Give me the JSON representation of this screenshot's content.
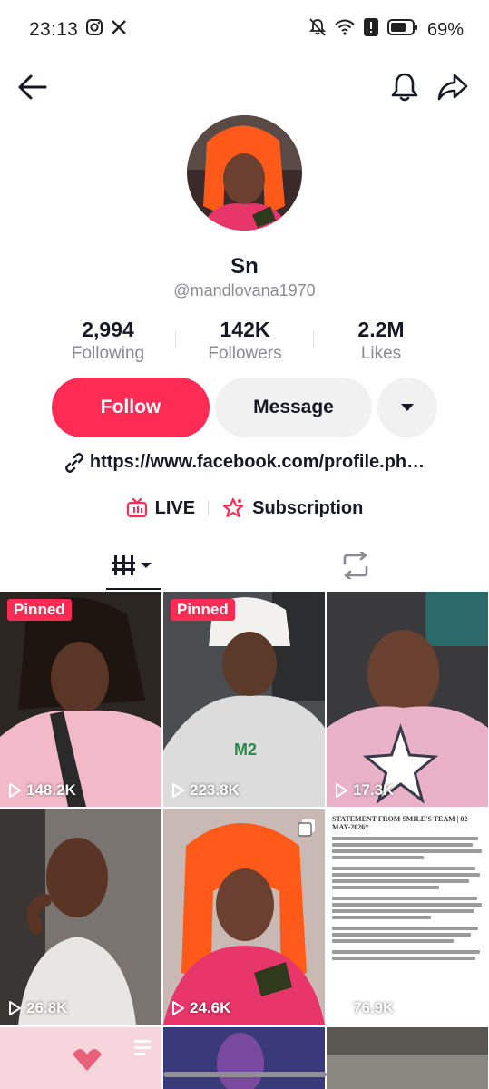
{
  "status_bar": {
    "time": "23:13",
    "battery_percent": "69%"
  },
  "profile": {
    "display_name": "Sn",
    "username": "@mandlovana1970",
    "bio_link": "https://www.facebook.com/profile.ph…"
  },
  "stats": [
    {
      "value": "2,994",
      "label": "Following"
    },
    {
      "value": "142K",
      "label": "Followers"
    },
    {
      "value": "2.2M",
      "label": "Likes"
    }
  ],
  "actions": {
    "follow_label": "Follow",
    "message_label": "Message"
  },
  "extras": {
    "live_label": "LIVE",
    "subscription_label": "Subscription"
  },
  "videos": [
    {
      "views": "148.2K",
      "pinned": "Pinned"
    },
    {
      "views": "223.8K",
      "pinned": "Pinned"
    },
    {
      "views": "17.3K"
    },
    {
      "views": "26.8K"
    },
    {
      "views": "24.6K"
    },
    {
      "views": "76.9K",
      "doc_title": "STATEMENT FROM SMILE'S TEAM | 02-MAY-2026*"
    }
  ],
  "colors": {
    "accent": "#fe2c55",
    "text": "#161823",
    "muted": "#8a8b91",
    "button_secondary": "#f1f1f2"
  }
}
